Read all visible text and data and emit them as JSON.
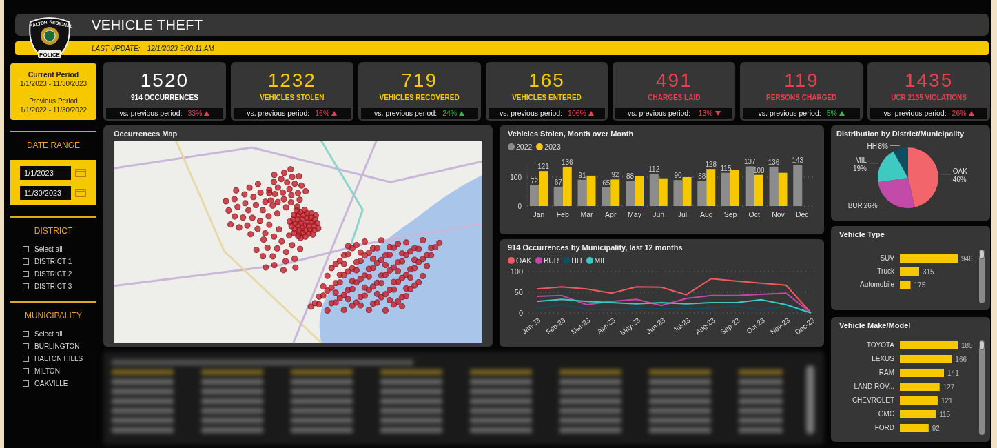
{
  "header": {
    "logo_top_left": "HALTON",
    "logo_top_right": "REGIONAL",
    "logo_bottom": "POLICE",
    "title": "VEHICLE THEFT",
    "update_label": "LAST UPDATE:",
    "update_value": "12/1/2023 5:00:11 AM"
  },
  "period": {
    "current_label": "Current Period",
    "current_range": "1/1/2023 - 11/30/2023",
    "previous_label": "Previous Period",
    "previous_range": "1/1/2022 - 11/30/2022"
  },
  "filters": [
    {
      "kind": "dates",
      "title": "DATE RANGE",
      "fields": [
        {
          "value": "1/1/2023"
        },
        {
          "value": "11/30/2023"
        }
      ]
    },
    {
      "kind": "checklist",
      "title": "DISTRICT",
      "items": [
        {
          "label": "Select all",
          "checked": false
        },
        {
          "label": "DISTRICT 1",
          "checked": false
        },
        {
          "label": "DISTRICT 2",
          "checked": false
        },
        {
          "label": "DISTRICT 3",
          "checked": false
        }
      ]
    },
    {
      "kind": "checklist",
      "title": "MUNICIPALITY",
      "items": [
        {
          "label": "Select all",
          "checked": false
        },
        {
          "label": "BURLINGTON",
          "checked": false
        },
        {
          "label": "HALTON HILLS",
          "checked": false
        },
        {
          "label": "MILTON",
          "checked": false
        },
        {
          "label": "OAKVILLE",
          "checked": false
        }
      ]
    }
  ],
  "kpis": [
    {
      "value": "1520",
      "label": "914 OCCURRENCES",
      "color": "#ffffff",
      "compare_label": "vs. previous period:",
      "change": "33%",
      "increase": true,
      "favorable": false
    },
    {
      "value": "1232",
      "label": "VEHICLES STOLEN",
      "color": "#f5c800",
      "compare_label": "vs. previous period:",
      "change": "16%",
      "increase": true,
      "favorable": false
    },
    {
      "value": "719",
      "label": "VEHICLES RECOVERED",
      "color": "#f5c800",
      "compare_label": "vs. previous period:",
      "change": "24%",
      "increase": true,
      "favorable": true
    },
    {
      "value": "165",
      "label": "VEHICLES ENTERED",
      "color": "#f5c800",
      "compare_label": "vs. previous period:",
      "change": "106%",
      "increase": true,
      "favorable": false
    },
    {
      "value": "491",
      "label": "CHARGES LAID",
      "color": "#e5404f",
      "compare_label": "vs. previous period:",
      "change": "-13%",
      "increase": false,
      "favorable": false
    },
    {
      "value": "119",
      "label": "PERSONS CHARGED",
      "color": "#e5404f",
      "compare_label": "vs. previous period:",
      "change": "5%",
      "increase": true,
      "favorable": true
    },
    {
      "value": "1435",
      "label": "UCR 2135 VIOLATIONS",
      "color": "#e5404f",
      "compare_label": "vs. previous period:",
      "change": "26%",
      "increase": true,
      "favorable": false
    }
  ],
  "map": {
    "title": "Occurrences Map"
  },
  "vehicles_stolen": {
    "title": "Vehicles Stolen, Month over Month",
    "chart_data": {
      "type": "bar",
      "legend": "top",
      "categories": [
        "Jan",
        "Feb",
        "Mar",
        "Apr",
        "May",
        "Jun",
        "Jul",
        "Aug",
        "Sep",
        "Oct",
        "Nov",
        "Dec"
      ],
      "ylim": [
        0,
        150
      ],
      "yticks": [
        0,
        100
      ],
      "data_labels": true,
      "series": [
        {
          "name": "2022",
          "color": "#8c8c8c",
          "values": [
            72,
            67,
            91,
            65,
            88,
            112,
            90,
            88,
            115,
            137,
            136,
            143
          ],
          "value_labels": [
            "72",
            "67",
            "91",
            "65",
            "88",
            "112",
            "90",
            "88",
            "115",
            "137",
            "136",
            "143"
          ]
        },
        {
          "name": "2023",
          "color": "#f5c800",
          "values": [
            121,
            136,
            105,
            92,
            103,
            96,
            100,
            128,
            124,
            108,
            115,
            null
          ],
          "value_labels": [
            "121",
            "136",
            null,
            "92",
            null,
            null,
            null,
            "128",
            null,
            "108",
            null,
            null
          ]
        }
      ]
    }
  },
  "occurrences_by_municipality": {
    "title": "914 Occurrences by Municipality, last 12 months",
    "chart_data": {
      "type": "line",
      "legend": "top",
      "x": [
        "Jan-23",
        "Feb-23",
        "Mar-23",
        "Apr-23",
        "May-23",
        "Jun-23",
        "Jul-23",
        "Aug-23",
        "Sep-23",
        "Oct-23",
        "Nov-23",
        "Dec-23"
      ],
      "ylim": [
        0,
        100
      ],
      "yticks": [
        0,
        50,
        100
      ],
      "series": [
        {
          "name": "OAK",
          "color": "#ee5a63",
          "values": [
            58,
            63,
            58,
            48,
            63,
            62,
            44,
            83,
            77,
            72,
            67,
            0
          ]
        },
        {
          "name": "BUR",
          "color": "#c548a8",
          "values": [
            40,
            42,
            20,
            28,
            33,
            18,
            35,
            42,
            42,
            45,
            48,
            0
          ]
        },
        {
          "name": "HH",
          "color": "#0f4d62",
          "values": [
            10,
            20,
            8,
            8,
            10,
            10,
            10,
            12,
            16,
            8,
            15,
            0
          ]
        },
        {
          "name": "MIL",
          "color": "#3ec9c1",
          "values": [
            28,
            33,
            28,
            25,
            22,
            25,
            22,
            25,
            25,
            32,
            20,
            0
          ]
        }
      ]
    }
  },
  "distribution": {
    "title": "Distribution by District/Municipality",
    "chart_data": {
      "type": "pie",
      "categories": [
        "OAK",
        "BUR",
        "MIL",
        "HH"
      ],
      "values": [
        46,
        26,
        19,
        8
      ],
      "colors": [
        "#f2666b",
        "#c24aa8",
        "#3ec9c1",
        "#0f4d62"
      ],
      "value_labels": [
        "46%",
        "26%",
        "19%",
        "8%"
      ]
    }
  },
  "vehicle_type": {
    "title": "Vehicle Type",
    "chart_data": {
      "type": "bar",
      "orientation": "horizontal",
      "categories": [
        "SUV",
        "Truck",
        "Automobile"
      ],
      "values": [
        946,
        315,
        175
      ],
      "data_labels": true
    }
  },
  "vehicle_make": {
    "title": "Vehicle Make/Model",
    "chart_data": {
      "type": "bar",
      "orientation": "horizontal",
      "categories": [
        "TOYOTA",
        "LEXUS",
        "RAM",
        "LAND ROV...",
        "CHEVROLET",
        "GMC",
        "FORD"
      ],
      "values": [
        185,
        166,
        141,
        127,
        121,
        115,
        92
      ],
      "data_labels": true
    }
  }
}
